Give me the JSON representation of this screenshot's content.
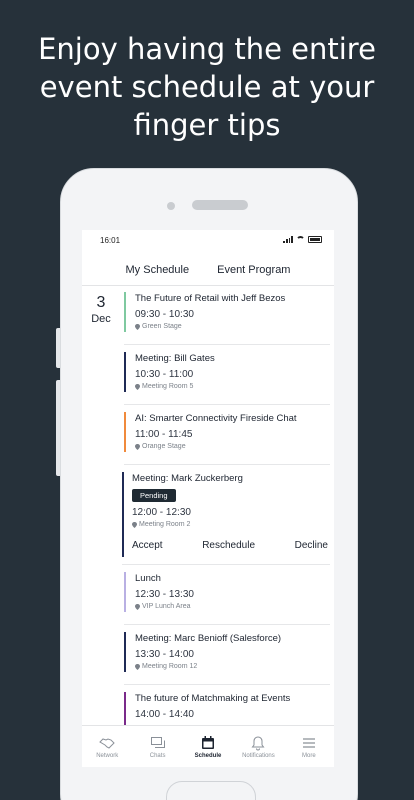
{
  "headline": [
    "Enjoy having the entire",
    "event schedule at your",
    "finger tips"
  ],
  "status": {
    "time": "16:01"
  },
  "tabs": {
    "my_schedule": "My Schedule",
    "event_program": "Event Program"
  },
  "date": {
    "day": "3",
    "month": "Dec"
  },
  "events": [
    {
      "title": "The Future of Retail with Jeff Bezos",
      "time": "09:30 - 10:30",
      "location": "Green Stage",
      "color": "#7fc9a0"
    },
    {
      "title": "Meeting: Bill Gates",
      "time": "10:30 - 11:00",
      "location": "Meeting Room 5",
      "color": "#1f2a55"
    },
    {
      "title": "AI: Smarter Connectivity Fireside Chat",
      "time": "11:00 - 11:45",
      "location": "Orange Stage",
      "color": "#f08a3c"
    },
    {
      "title": "Meeting: Mark Zuckerberg",
      "badge": "Pending",
      "time": "12:00 - 12:30",
      "location": "Meeting Room 2",
      "color": "#1f2a55",
      "actions": {
        "accept": "Accept",
        "reschedule": "Reschedule",
        "decline": "Decline"
      }
    },
    {
      "title": "Lunch",
      "time": "12:30 - 13:30",
      "location": "VIP Lunch Area",
      "color": "#b9b0e3"
    },
    {
      "title": "Meeting: Marc Benioff (Salesforce)",
      "time": "13:30 - 14:00",
      "location": "Meeting Room 12",
      "color": "#1f2a55"
    },
    {
      "title": "The future of Matchmaking at Events",
      "time": "14:00 - 14:40",
      "location": "",
      "color": "#7a2a8a"
    }
  ],
  "nav": {
    "network": "Network",
    "chats": "Chats",
    "schedule": "Schedule",
    "notifications": "Notifications",
    "more": "More"
  }
}
